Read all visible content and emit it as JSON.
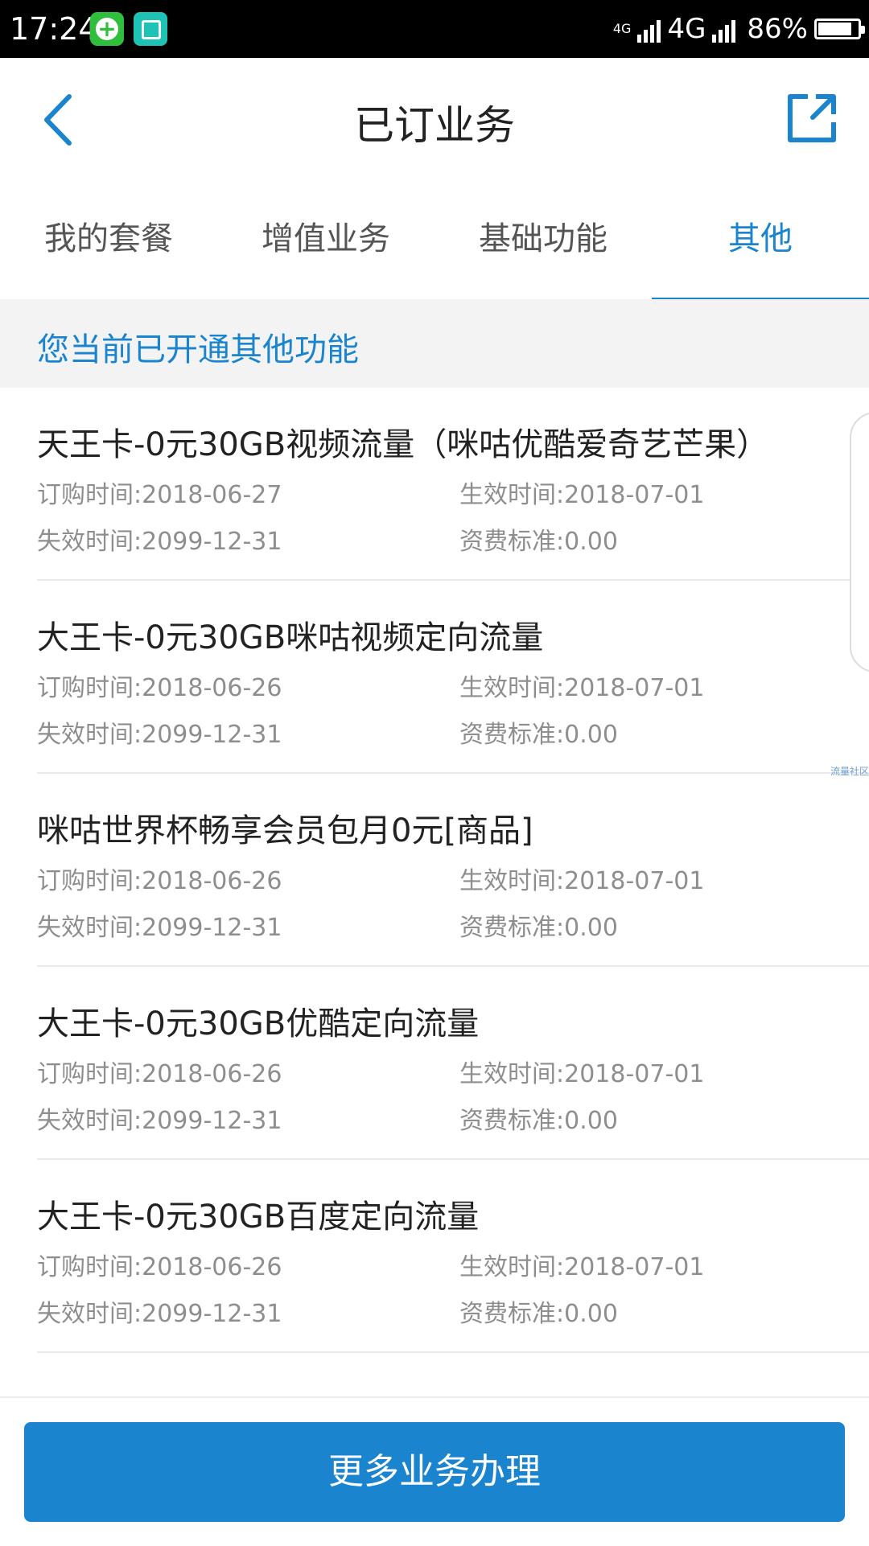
{
  "status_bar": {
    "time": "17:24",
    "sim1_label": "4G",
    "network": "4G",
    "battery": "86%",
    "battery_level": 0.86,
    "icons": [
      "app-green-plus-icon",
      "app-scan-icon",
      "signal-icon",
      "battery-icon"
    ]
  },
  "header": {
    "title": "已订业务",
    "back_icon": "back-chevron-icon",
    "share_icon": "share-external-icon",
    "accent_color": "#1a84cf"
  },
  "tabs": [
    {
      "label": "我的套餐",
      "active": false
    },
    {
      "label": "增值业务",
      "active": false
    },
    {
      "label": "基础功能",
      "active": false
    },
    {
      "label": "其他",
      "active": true
    }
  ],
  "section": {
    "title": "您当前已开通其他功能"
  },
  "items": [
    {
      "title": "天王卡-0元30GB视频流量（咪咕优酷爱奇艺芒果）",
      "order_time": "订购时间:2018-06-27",
      "effective_time": "生效时间:2018-07-01",
      "expire_time": "失效时间:2099-12-31",
      "fee": "资费标准:0.00"
    },
    {
      "title": "大王卡-0元30GB咪咕视频定向流量",
      "order_time": "订购时间:2018-06-26",
      "effective_time": "生效时间:2018-07-01",
      "expire_time": "失效时间:2099-12-31",
      "fee": "资费标准:0.00"
    },
    {
      "title": "咪咕世界杯畅享会员包月0元[商品]",
      "order_time": "订购时间:2018-06-26",
      "effective_time": "生效时间:2018-07-01",
      "expire_time": "失效时间:2099-12-31",
      "fee": "资费标准:0.00"
    },
    {
      "title": "大王卡-0元30GB优酷定向流量",
      "order_time": "订购时间:2018-06-26",
      "effective_time": "生效时间:2018-07-01",
      "expire_time": "失效时间:2099-12-31",
      "fee": "资费标准:0.00"
    },
    {
      "title": "大王卡-0元30GB百度定向流量",
      "order_time": "订购时间:2018-06-26",
      "effective_time": "生效时间:2018-07-01",
      "expire_time": "失效时间:2099-12-31",
      "fee": "资费标准:0.00"
    }
  ],
  "watermark": "流量社区",
  "footer": {
    "button_label": "更多业务办理"
  }
}
